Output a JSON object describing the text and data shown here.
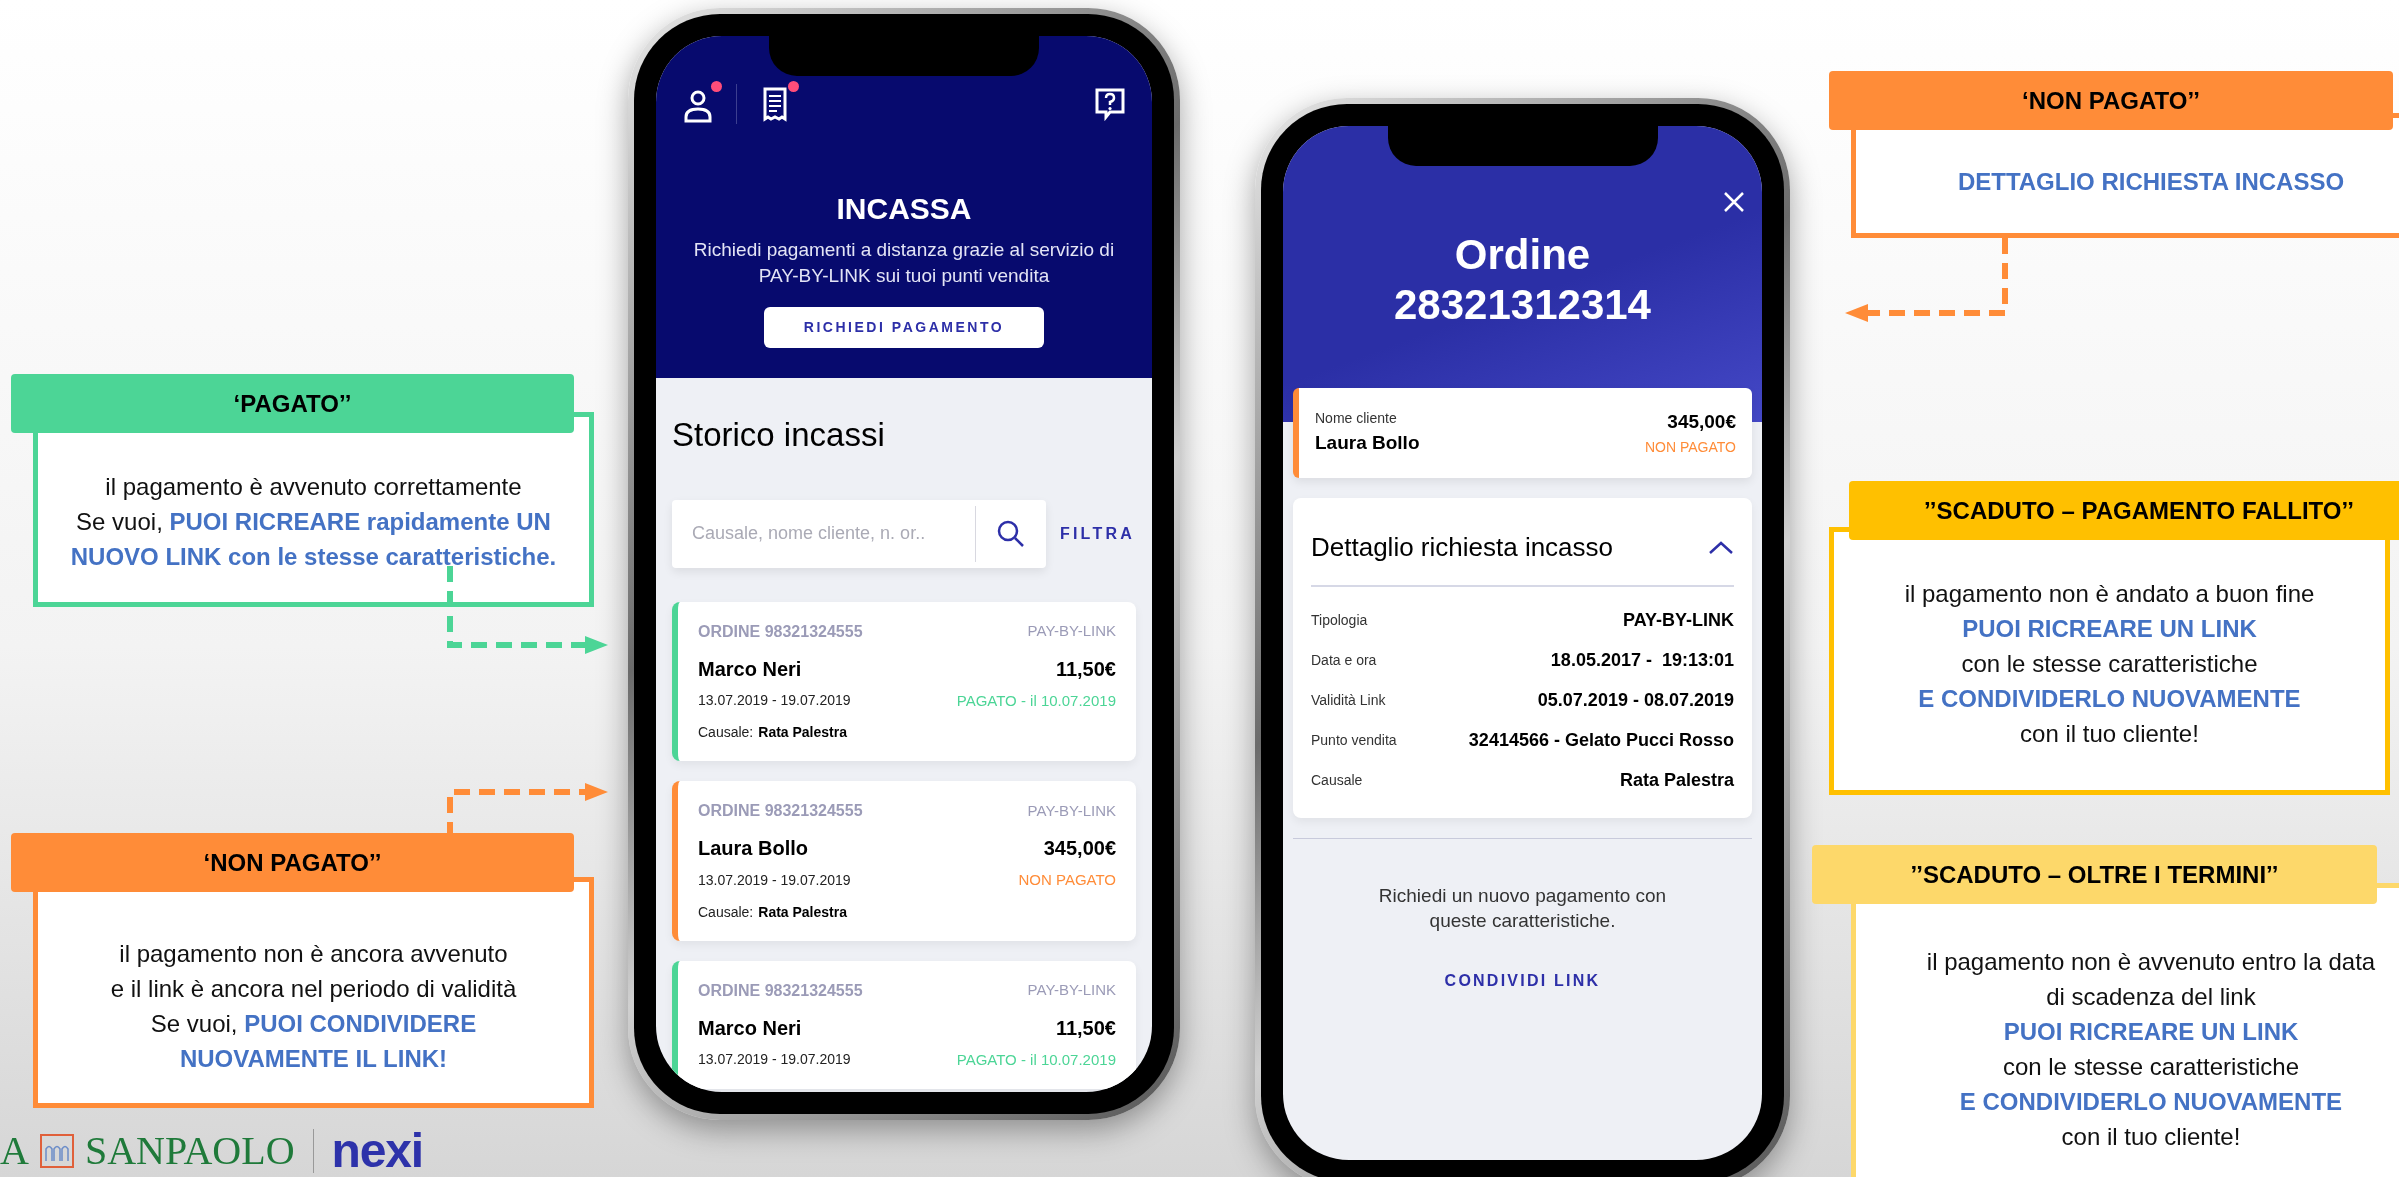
{
  "callouts": [
    {
      "title": "‘PAGATO’’",
      "color": "#4cd596",
      "lines": [
        "il pagamento è avvenuto correttamente",
        "Se vuoi, **PUOI RICREARE rapidamente UN**",
        "**NUOVO LINK con le stesse caratteristiche.**"
      ]
    },
    {
      "title": "‘NON PAGATO’’",
      "color": "#ff8c38",
      "lines": [
        "il pagamento non è ancora avvenuto",
        "e il link è ancora nel periodo di validità",
        "Se vuoi, **PUOI CONDIVIDERE**",
        "**NUOVAMENTE IL LINK!**"
      ]
    },
    {
      "title": "‘NON PAGATO’’",
      "color": "#ff8c38",
      "lines": [
        "**DETTAGLIO RICHIESTA INCASSO**"
      ]
    },
    {
      "title": "’’SCADUTO – PAGAMENTO FALLITO’’",
      "color": "#ffc000",
      "lines": [
        "il pagamento non è andato a buon fine",
        "**PUOI RICREARE UN LINK**",
        "con le stesse caratteristiche",
        "**E CONDIVIDERLO NUOVAMENTE**",
        "con il tuo cliente!"
      ]
    },
    {
      "title": "’’SCADUTO – OLTRE I TERMINI’’",
      "color": "#fdd86a",
      "lines": [
        "il pagamento non è avvenuto entro la data",
        "di scadenza del link",
        "**PUOI RICREARE UN LINK**",
        "con le stesse caratteristiche",
        "**E CONDIVIDERLO NUOVAMENTE**",
        "con il tuo cliente!"
      ]
    }
  ],
  "logo": {
    "bank_fragment": "A",
    "bank": "SANPAOLO",
    "brand": "nexi"
  },
  "list_screen": {
    "top_icons": [
      {
        "kind": "profile",
        "notification": true
      },
      {
        "kind": "receipt",
        "notification": true
      },
      {
        "kind": "help",
        "notification": false
      }
    ],
    "title": "INCASSA",
    "subtitle": "Richiedi pagamenti a distanza grazie al servizio di PAY-BY-LINK sui tuoi punti vendita",
    "button": "RICHIEDI PAGAMENTO",
    "section_title": "Storico incassi",
    "search": {
      "placeholder": "Causale, nome cliente, n. or.."
    },
    "filter": "FILTRA",
    "orders": [
      {
        "order": "ORDINE 98321324555",
        "type": "PAY-BY-LINK",
        "name": "Marco Neri",
        "amount": "11,50€",
        "dates": "13.07.2019 - 19.07.2019",
        "status": "PAGATO - il 10.07.2019",
        "color": "#4cd596",
        "causale_label": "Causale:",
        "causale": "Rata Palestra"
      },
      {
        "order": "ORDINE 98321324555",
        "type": "PAY-BY-LINK",
        "name": "Laura Bollo",
        "amount": "345,00€",
        "dates": "13.07.2019 - 19.07.2019",
        "status": "NON PAGATO",
        "color": "#ff8c38",
        "causale_label": "Causale:",
        "causale": "Rata Palestra"
      },
      {
        "order": "ORDINE 98321324555",
        "type": "PAY-BY-LINK",
        "name": "Marco Neri",
        "amount": "11,50€",
        "dates": "13.07.2019 - 19.07.2019",
        "status": "PAGATO - il 10.07.2019",
        "color": "#4cd596"
      }
    ]
  },
  "detail_screen": {
    "title_lines": [
      "Ordine",
      "28321312314"
    ],
    "customer": {
      "label": "Nome cliente",
      "name": "Laura Bollo",
      "amount": "345,00€",
      "status": "NON PAGATO",
      "color": "#ff8c38"
    },
    "detail": {
      "title": "Dettaglio richiesta incasso",
      "expanded": true,
      "rows": [
        {
          "label": "Tipologia",
          "value": "PAY-BY-LINK"
        },
        {
          "label": "Data e ora",
          "value": "18.05.2017 -  19:13:01"
        },
        {
          "label": "Validità Link",
          "value": "05.07.2019 - 08.07.2019"
        },
        {
          "label": "Punto vendita",
          "value": "32414566 - Gelato Pucci Rosso"
        },
        {
          "label": "Causale",
          "value": "Rata Palestra"
        }
      ]
    },
    "footer_text": "Richiedi un nuovo pagamento con queste caratteristiche.",
    "link": "CONDIVIDI LINK"
  }
}
